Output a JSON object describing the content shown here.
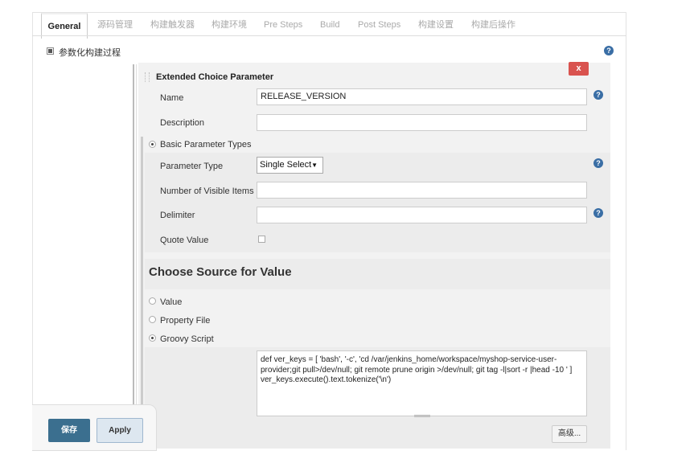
{
  "tabs": [
    "General",
    "源码管理",
    "构建触发器",
    "构建环境",
    "Pre Steps",
    "Build",
    "Post Steps",
    "构建设置",
    "构建后操作"
  ],
  "parameterized": {
    "label": "参数化构建过程",
    "checked": true
  },
  "param_block": {
    "title": "Extended Choice Parameter",
    "delete_label": "x",
    "name_label": "Name",
    "name_value": "RELEASE_VERSION",
    "description_label": "Description",
    "description_value": "",
    "basic_types_label": "Basic Parameter Types",
    "param_type_label": "Parameter Type",
    "param_type_value": "Single Select",
    "visible_items_label": "Number of Visible Items",
    "visible_items_value": "",
    "delimiter_label": "Delimiter",
    "delimiter_value": "",
    "quote_value_label": "Quote Value",
    "quote_value_checked": false
  },
  "source": {
    "heading": "Choose Source for Value",
    "options": [
      "Value",
      "Property File",
      "Groovy Script"
    ],
    "selected": "Groovy Script",
    "groovy_script": "def ver_keys = [ 'bash', '-c', 'cd /var/jenkins_home/workspace/myshop-service-user-provider;git pull>/dev/null; git remote prune origin >/dev/null; git tag -l|sort -r |head -10 ' ]\nver_keys.execute().text.tokenize('\\n')"
  },
  "buttons": {
    "save": "保存",
    "apply": "Apply",
    "advanced": "高级..."
  },
  "help_icon_glyph": "?",
  "colors": {
    "delete": "#d9534f",
    "save": "#3b6f8f",
    "help": "#3a6ea5"
  }
}
